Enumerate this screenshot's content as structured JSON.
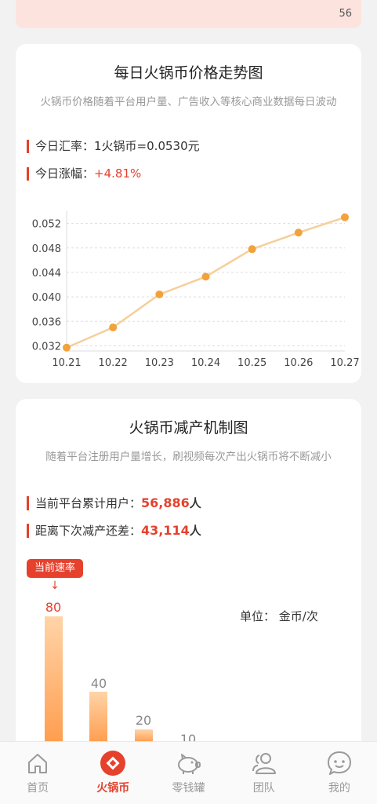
{
  "status_strip": {
    "count": "56"
  },
  "price_card": {
    "title": "每日火锅币价格走势图",
    "subtitle": "火锅币价格随着平台用户量、广告收入等核心商业数据每日波动",
    "rate_label": "今日汇率：",
    "rate_value": "1火锅币=0.0530元",
    "change_label": "今日涨幅：",
    "change_value": "+4.81%"
  },
  "chart_data": {
    "type": "line",
    "categories": [
      "10.21",
      "10.22",
      "10.23",
      "10.24",
      "10.25",
      "10.26",
      "10.27"
    ],
    "values": [
      0.0317,
      0.035,
      0.0404,
      0.0433,
      0.0478,
      0.0505,
      0.053
    ],
    "yticks": [
      "0.032",
      "0.036",
      "0.040",
      "0.044",
      "0.048",
      "0.052"
    ],
    "ylim": [
      0.03,
      0.054
    ],
    "grid": true,
    "line_color": "#f6cf9a",
    "point_color": "#f2a23c"
  },
  "reduction_card": {
    "title": "火锅币减产机制图",
    "subtitle": "随着平台注册用户量增长，刷视频每次产出火锅币将不断减小",
    "users_label": "当前平台累计用户：",
    "users_value": "56,886",
    "users_unit": "人",
    "next_label": "距离下次减产还差：",
    "next_value": "43,114",
    "next_unit": "人",
    "current_rate_badge": "当前速率",
    "arrow": "↓",
    "unit_note": "单位：  金币/次",
    "bars": [
      {
        "label": "80",
        "value": 80
      },
      {
        "label": "40",
        "value": 40
      },
      {
        "label": "20",
        "value": 20
      },
      {
        "label": "10",
        "value": 10
      }
    ]
  },
  "tabbar": {
    "accent": "#e5412d",
    "items": [
      {
        "label": "首页",
        "icon": "home-icon"
      },
      {
        "label": "火锅币",
        "icon": "hotpot-coin-icon"
      },
      {
        "label": "零钱罐",
        "icon": "piggy-bank-icon"
      },
      {
        "label": "团队",
        "icon": "team-icon"
      },
      {
        "label": "我的",
        "icon": "profile-icon"
      }
    ]
  }
}
